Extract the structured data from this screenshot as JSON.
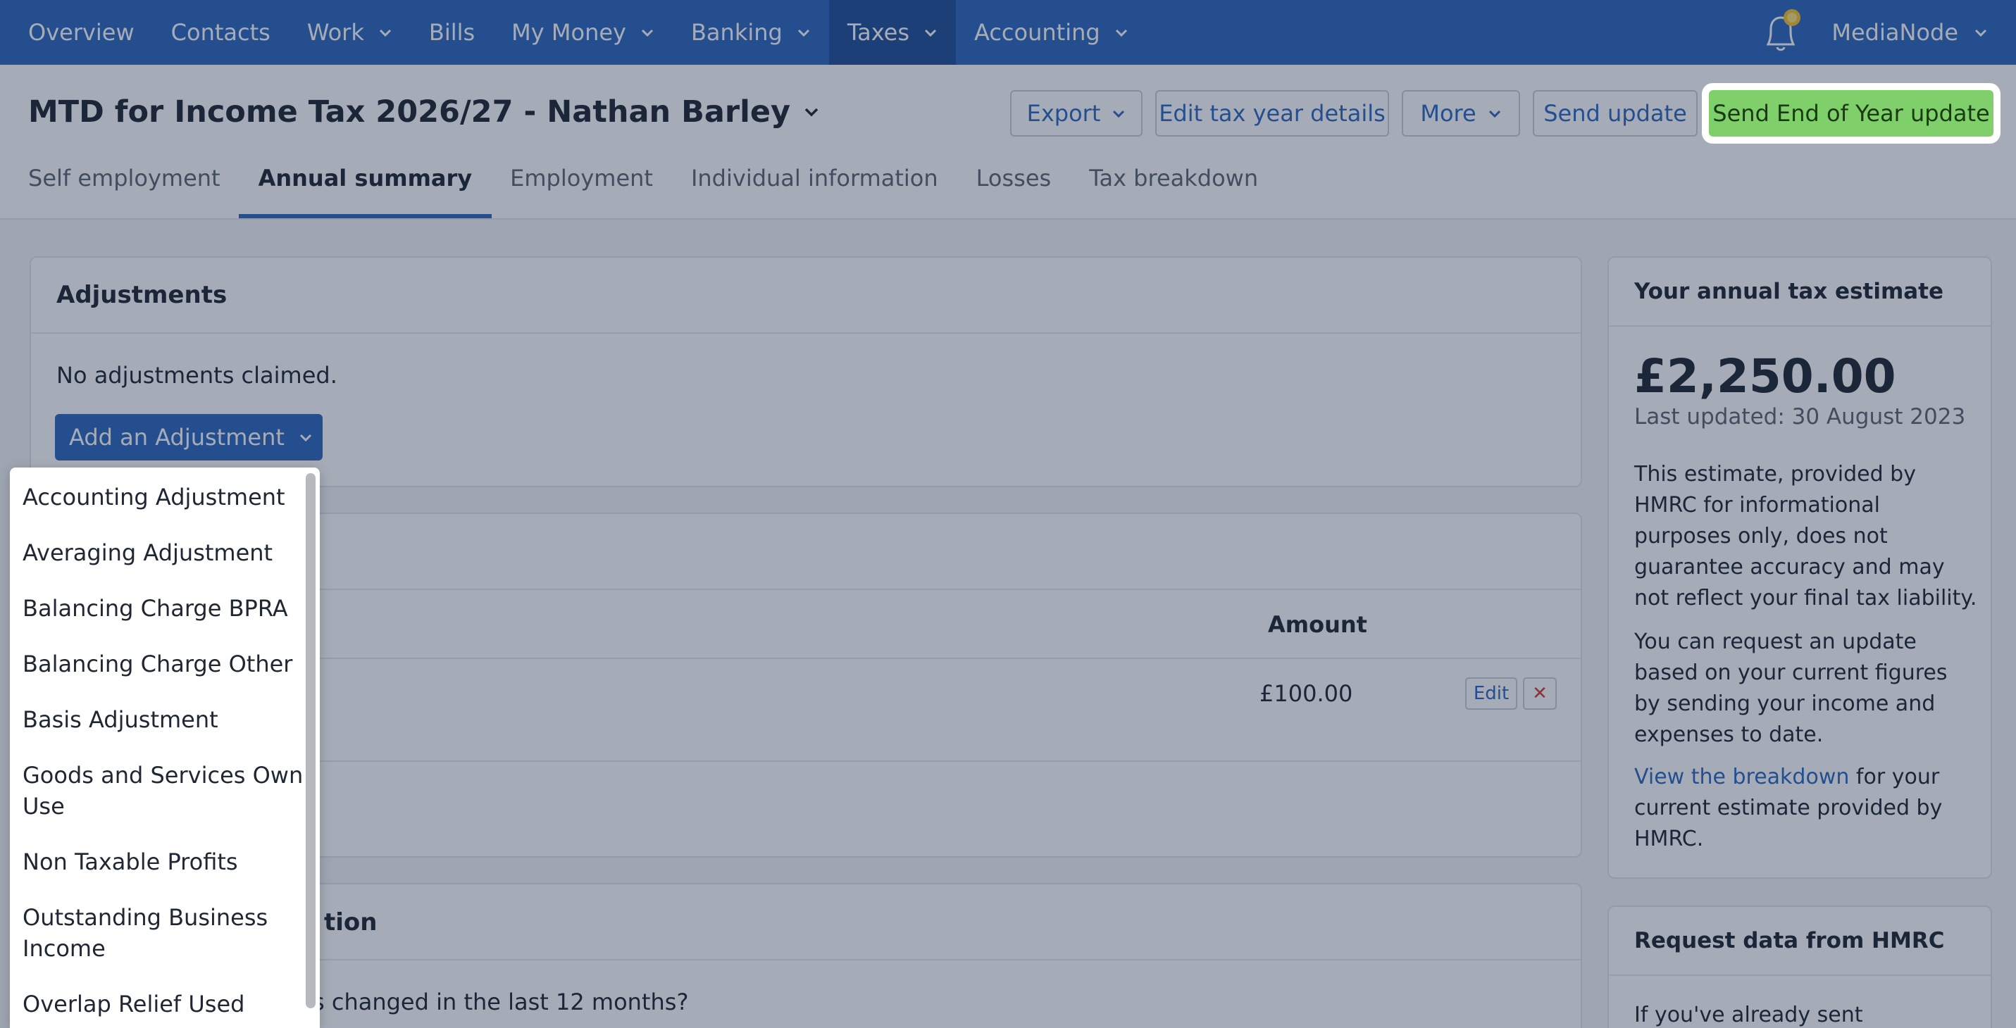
{
  "nav": {
    "items": [
      {
        "label": "Overview",
        "dropdown": false
      },
      {
        "label": "Contacts",
        "dropdown": false
      },
      {
        "label": "Work",
        "dropdown": true
      },
      {
        "label": "Bills",
        "dropdown": false
      },
      {
        "label": "My Money",
        "dropdown": true
      },
      {
        "label": "Banking",
        "dropdown": true
      },
      {
        "label": "Taxes",
        "dropdown": true,
        "active": true
      },
      {
        "label": "Accounting",
        "dropdown": true
      }
    ],
    "org_name": "MediaNode",
    "bell_icon": "bell-icon"
  },
  "header": {
    "title": "MTD for Income Tax 2026/27 - Nathan Barley",
    "buttons": {
      "export": "Export",
      "edit_tax_year": "Edit tax year details",
      "more": "More",
      "send_update": "Send update",
      "send_eoy": "Send End of Year update"
    },
    "tabs": [
      "Self employment",
      "Annual summary",
      "Employment",
      "Individual information",
      "Losses",
      "Tax breakdown"
    ],
    "active_tab": "Annual summary"
  },
  "adjustments": {
    "title": "Adjustments",
    "empty_text": "No adjustments claimed.",
    "add_button": "Add an Adjustment"
  },
  "allowances": {
    "amount_header": "Amount",
    "row_amount": "£100.00",
    "edit_label": "Edit",
    "delete_label": "✕"
  },
  "info_section": {
    "title_fragment": "tion",
    "question_fragment": "s changed in the last 12 months?"
  },
  "estimate": {
    "title": "Your annual tax estimate",
    "amount": "£2,250.00",
    "last_updated": "Last updated: 30 August 2023",
    "para1": "This estimate, provided by HMRC for informational purposes only, does not guarantee accuracy and may not reflect your final tax liability.",
    "para2": "You can request an update based on your current figures by sending your income and expenses to date.",
    "breakdown_link": "View the breakdown",
    "breakdown_rest": " for your current estimate provided by HMRC."
  },
  "request": {
    "title": "Request data from HMRC",
    "text": "If you've already sent"
  },
  "menu": {
    "items": [
      "Accounting Adjustment",
      "Averaging Adjustment",
      "Balancing Charge BPRA",
      "Balancing Charge Other",
      "Basis Adjustment",
      "Goods and Services Own Use",
      "Non Taxable Profits",
      "Outstanding Business Income",
      "Overlap Relief Used"
    ]
  },
  "colors": {
    "nav_bg": "#2f68bf",
    "nav_active": "#234f99",
    "primary_blue": "#2f68bf",
    "eoy_green": "#7fd06a",
    "delete_red": "#d43b3b"
  }
}
